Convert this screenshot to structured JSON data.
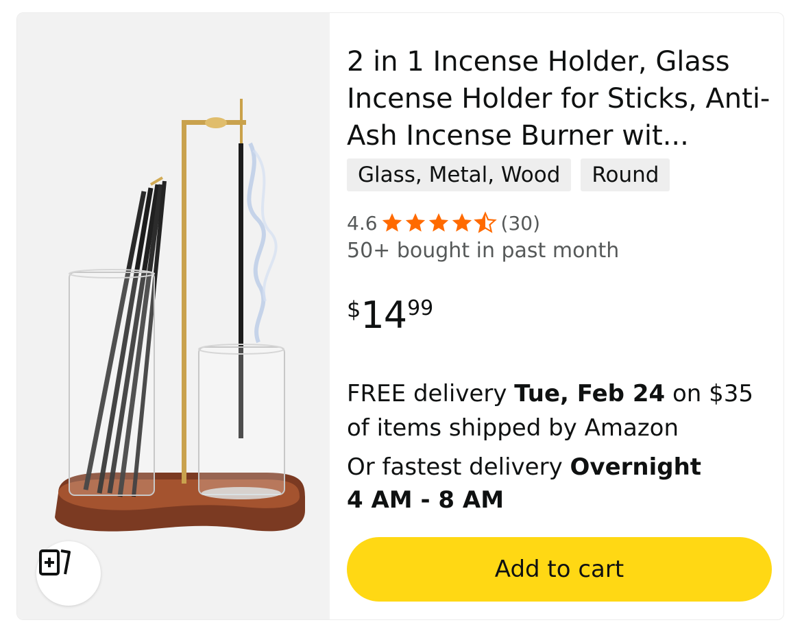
{
  "product": {
    "title": "2 in 1 Incense Holder, Glass Incense Holder for Sticks, Anti-Ash Incense Burner wit...",
    "chips": [
      "Glass, Metal, Wood",
      "Round"
    ],
    "rating": {
      "value_text": "4.6",
      "value": 4.6,
      "count_text": "(30)",
      "stars_filled": 4,
      "stars_half": 1,
      "star_color": "#ff6a00"
    },
    "bought_text": "50+ bought in past month",
    "price": {
      "symbol": "$",
      "whole": "14",
      "fraction": "99"
    },
    "delivery": {
      "prefix": "FREE delivery ",
      "date": "Tue, Feb 24",
      "suffix": " on $35 of items shipped by Amazon"
    },
    "fastest": {
      "prefix": "Or fastest delivery ",
      "speed": "Overnight",
      "window": "4 AM - 8 AM"
    },
    "add_to_cart_label": "Add to cart",
    "colors": {
      "button": "#ffd814",
      "chip": "#eeeeee",
      "muted_text": "#565959"
    }
  },
  "image": {
    "description_icon": "incense-holder-product-photo",
    "compare_icon": "compare-icon"
  }
}
